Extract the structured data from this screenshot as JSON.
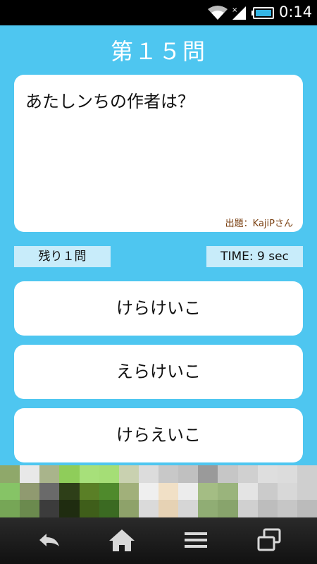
{
  "status_bar": {
    "time": "0:14",
    "icons": [
      "wifi-icon",
      "signal-icon",
      "battery-icon"
    ]
  },
  "quiz": {
    "question_number": "第１５問",
    "question": "あたしンちの作者は？",
    "credit": "出題：KajiPさん",
    "remaining": "残り１問",
    "timer": "TIME:  9 sec",
    "answers": [
      "けらけいこ",
      "えらけいこ",
      "けらえいこ"
    ]
  },
  "ad_banner": {
    "colors": [
      "#8fa86a",
      "#e8e8e8",
      "#a9b48b",
      "#8fcd5a",
      "#a7e07a",
      "#a5de76",
      "#c9d1b0",
      "#dcdcdc",
      "#c8c8c8",
      "#c0c0c0",
      "#9a9a9a",
      "#c6c6c6",
      "#d0d0d0",
      "#dedede",
      "#dcdcdc",
      "#cfcfcf",
      "#86c466",
      "#909a70",
      "#6a6a6a",
      "#2e3f18",
      "#5a7f26",
      "#4f8a2c",
      "#a1b07a",
      "#efefef",
      "#f1e0c6",
      "#ececec",
      "#a4bd84",
      "#9ab47c",
      "#e4e4e4",
      "#cbcbcb",
      "#d8d8d8",
      "#cfcfcf",
      "#76a656",
      "#6b8a4e",
      "#3c3c3c",
      "#1f2c10",
      "#3f5e1a",
      "#3b6a22",
      "#8ea26a",
      "#dadada",
      "#e6d2b4",
      "#d6d6d6",
      "#90ad74",
      "#88a46c",
      "#d0d0d0",
      "#bdbdbd",
      "#c6c6c6",
      "#bbbbbb"
    ]
  },
  "nav_bar": {
    "buttons": [
      "back-icon",
      "home-icon",
      "menu-icon",
      "recent-apps-icon"
    ]
  },
  "colors": {
    "background": "#4ec6f0",
    "label_box": "#c8ecfa",
    "credit_text": "#7a3f10"
  }
}
